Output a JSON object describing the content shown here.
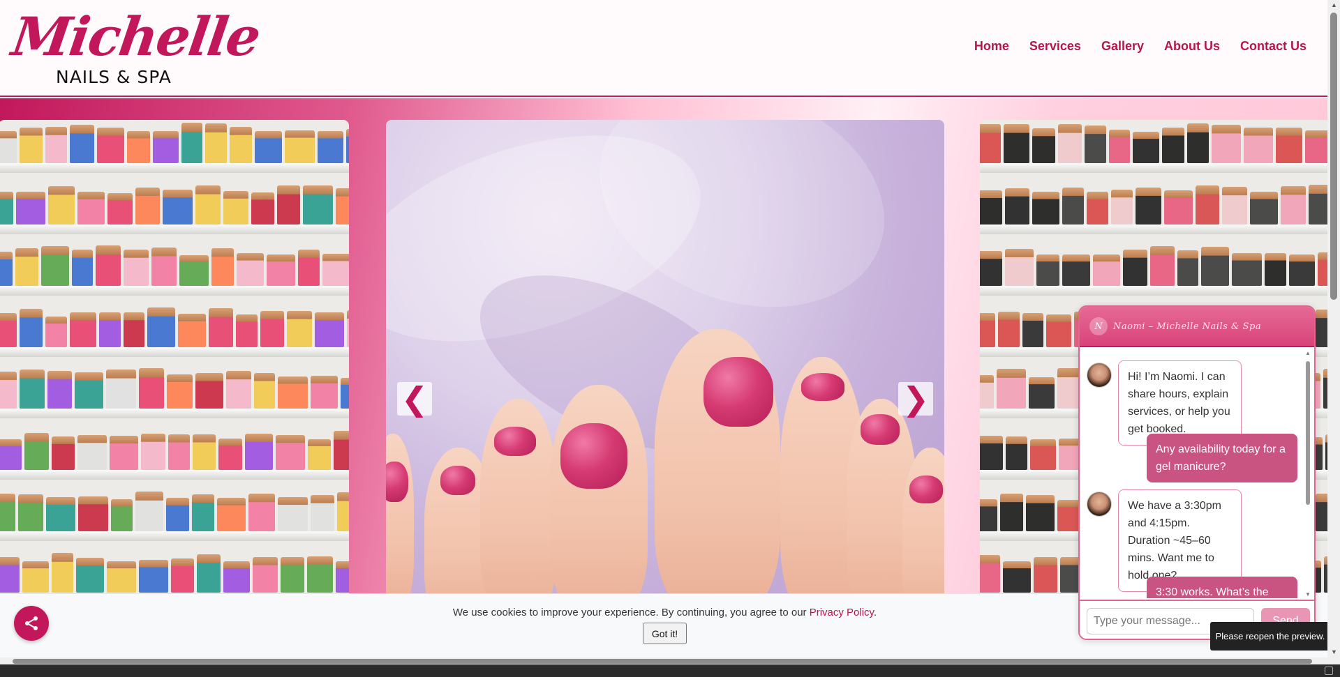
{
  "brand": {
    "logo_script": "Michelle",
    "logo_sub": "NAILS & SPA"
  },
  "nav": {
    "items": [
      {
        "label": "Home"
      },
      {
        "label": "Services"
      },
      {
        "label": "Gallery"
      },
      {
        "label": "About Us"
      },
      {
        "label": "Contact Us"
      }
    ]
  },
  "carousel": {
    "prev_icon": "❮",
    "next_icon": "❯"
  },
  "chat": {
    "avatar_letter": "N",
    "title": "Naomi – Michelle Nails & Spa",
    "messages": [
      {
        "from": "bot",
        "text": "Hi! I’m Naomi. I can share hours, explain services, or help you get booked."
      },
      {
        "from": "user",
        "text": "Any availability today for a gel manicure?"
      },
      {
        "from": "bot",
        "text": "We have a 3:30pm and 4:15pm. Duration ~45–60 mins. Want me to hold one?"
      },
      {
        "from": "user",
        "text": "3:30 works. What’s the"
      }
    ],
    "input_placeholder": "Type your message...",
    "send_label": "Send"
  },
  "cookie": {
    "text": "We use cookies to improve your experience. By continuing, you agree to our ",
    "link": "Privacy Policy",
    "after": ".",
    "button": "Got it!"
  },
  "tooltip": "Please reopen the preview.",
  "colors": {
    "brand": "#c2185b",
    "chat_user_bubble": "#c95482"
  },
  "icons": {
    "share": "share-icon",
    "prev": "chevron-left-icon",
    "next": "chevron-right-icon"
  }
}
